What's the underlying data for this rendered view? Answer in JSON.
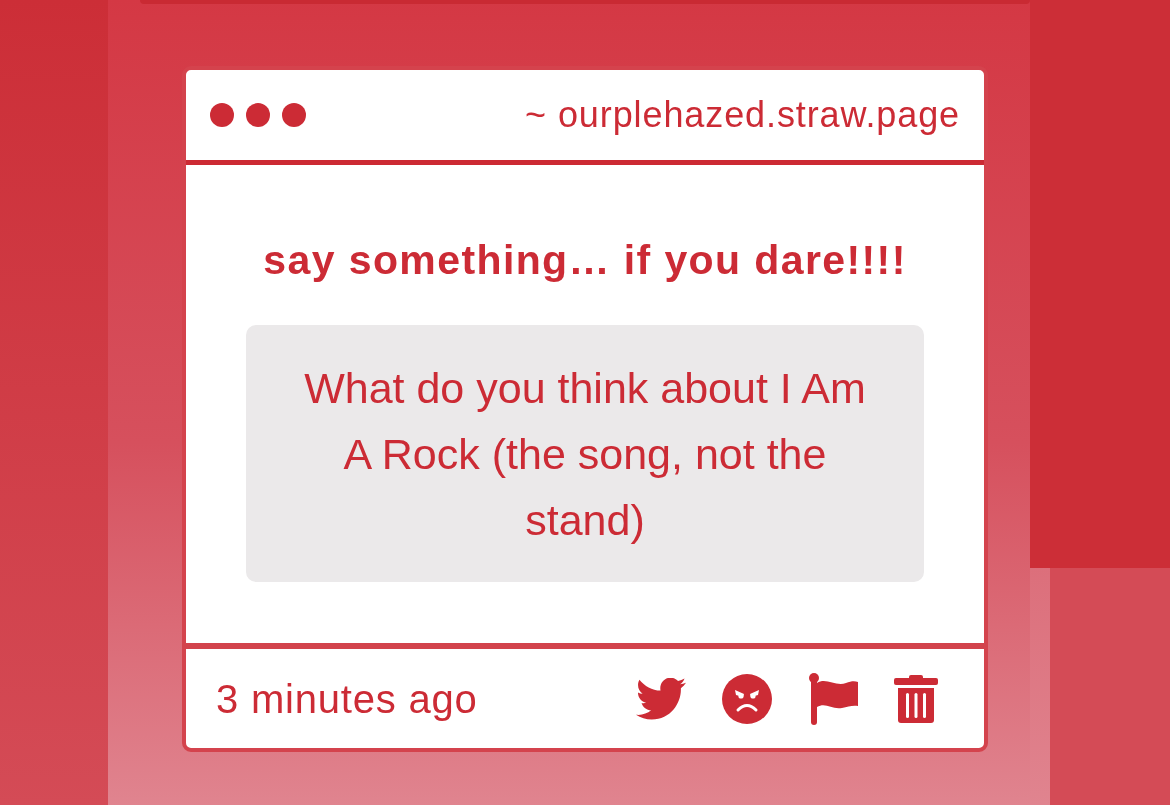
{
  "window": {
    "url": "~ ourplehazed.straw.page"
  },
  "post": {
    "heading": "say something… if you dare!!!!",
    "question": "What do you think about I Am A Rock (the song, not the stand)",
    "time": "3 minutes ago"
  }
}
